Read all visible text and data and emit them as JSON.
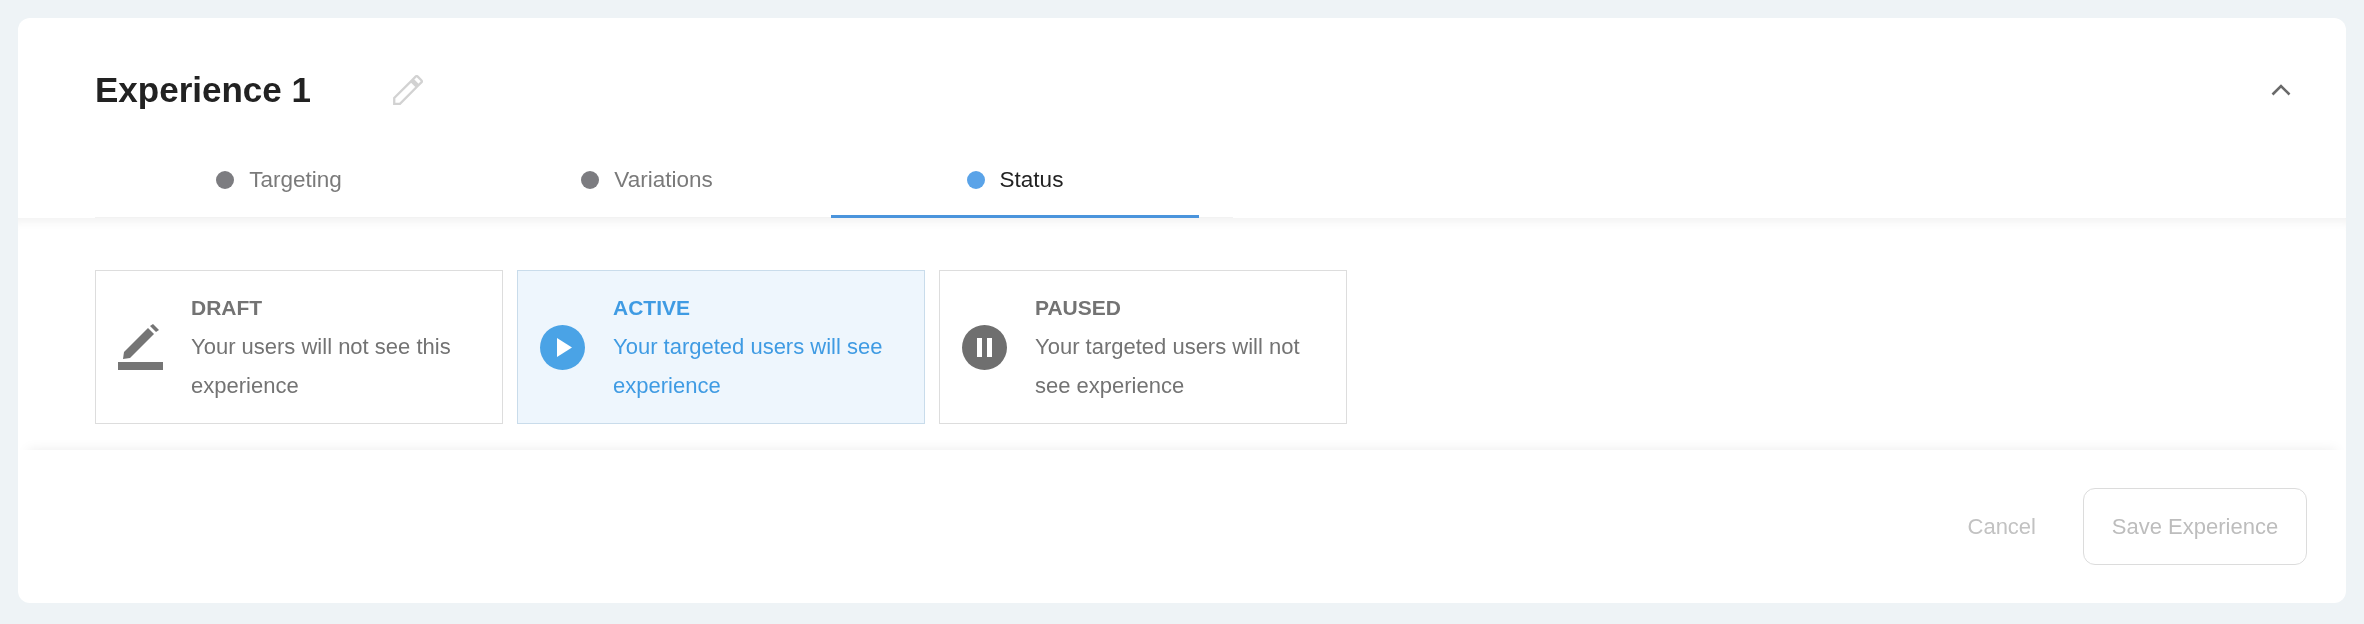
{
  "experience": {
    "title": "Experience 1",
    "expanded": true
  },
  "tabs": [
    {
      "label": "Targeting",
      "selected": false
    },
    {
      "label": "Variations",
      "selected": false
    },
    {
      "label": "Status",
      "selected": true
    }
  ],
  "status_options": [
    {
      "kind": "draft",
      "title": "DRAFT",
      "description": "Your users will not see this experience",
      "selected": false
    },
    {
      "kind": "active",
      "title": "ACTIVE",
      "description": "Your targeted users will see experience",
      "selected": true
    },
    {
      "kind": "paused",
      "title": "PAUSED",
      "description": "Your targeted users will not see experience",
      "selected": false
    }
  ],
  "footer": {
    "buttons": [
      {
        "kind": "text",
        "label": "Cancel",
        "disabled": true
      },
      {
        "kind": "outlined",
        "label": "Save Experience",
        "disabled": true
      }
    ]
  }
}
